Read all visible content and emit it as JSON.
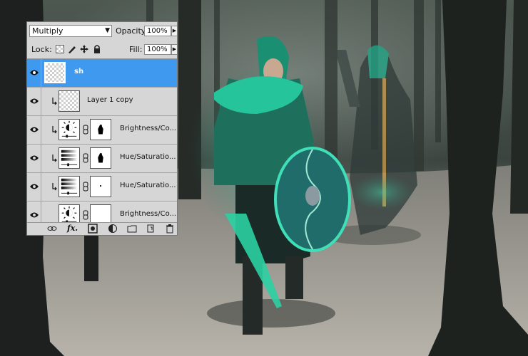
{
  "layers_panel": {
    "blend_mode": "Multiply",
    "opacity_label": "Opacity:",
    "opacity_value": "100%",
    "lock_label": "Lock:",
    "fill_label": "Fill:",
    "fill_value": "100%",
    "layers": [
      {
        "name": "sh",
        "selected": true,
        "thumb": "checker"
      },
      {
        "name": "Layer 1 copy",
        "thumb": "checker",
        "clipped": true
      },
      {
        "name": "Brightness/Co...",
        "thumb": "brightness-adjustment-icon",
        "clipped": true,
        "mask": "black-figure"
      },
      {
        "name": "Hue/Saturatio...",
        "thumb": "hue-saturation-adjustment-icon",
        "clipped": true,
        "mask": "black-figure"
      },
      {
        "name": "Hue/Saturatio...",
        "thumb": "hue-saturation-adjustment-icon",
        "clipped": true,
        "mask": "dot"
      },
      {
        "name": "Brightness/Co...",
        "thumb": "brightness-adjustment-icon",
        "clipped": false,
        "mask": "white"
      }
    ],
    "footer_icons": [
      "link-layers-icon",
      "fx-icon",
      "add-mask-icon",
      "adjustment-layer-icon",
      "new-group-icon",
      "new-layer-icon",
      "trash-icon"
    ]
  },
  "colors": {
    "selection": "#3f99ee",
    "panel": "#d6d6d6",
    "glow": "#1fc49a"
  }
}
